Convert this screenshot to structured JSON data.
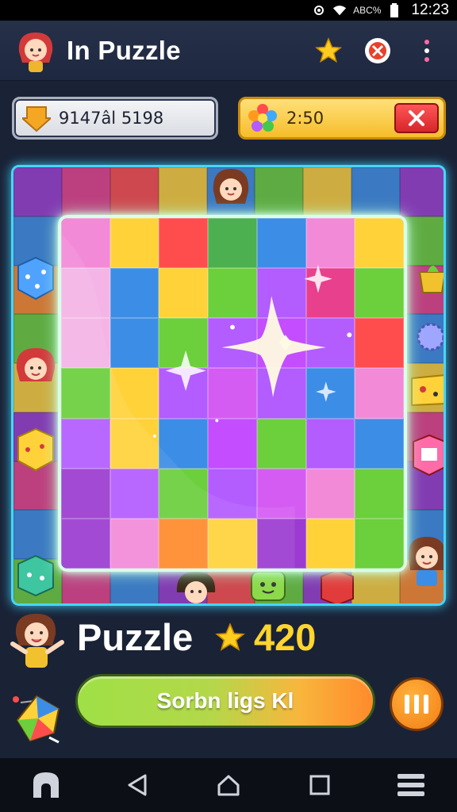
{
  "status_bar": {
    "carrier_text": "ABC%",
    "time": "12:23",
    "icons": [
      "settings-icon",
      "wifi-icon",
      "battery-icon"
    ]
  },
  "header": {
    "title": "In Puzzle",
    "icons": [
      "avatar",
      "star-icon",
      "no-ads-icon",
      "more-icon"
    ]
  },
  "info": {
    "left_value": "9147âl 5198",
    "left_icon": "arrow-down-icon",
    "right_value": "2:50",
    "right_icon": "flower-icon",
    "close_icon": "close-icon"
  },
  "footer": {
    "label": "Puzzle",
    "score": "420",
    "action_label": "Sorbn ligs Kl",
    "pause_icon": "pause-icon"
  },
  "nav": {
    "icons": [
      "app-icon",
      "back-icon",
      "home-icon",
      "recents-icon",
      "menu-icon"
    ]
  },
  "colors": {
    "accent_gold": "#ffd52e",
    "board_glow": "#48d6f7",
    "close_red": "#d6262a",
    "button_green": "#9fe046",
    "button_orange": "#ff8a2c"
  }
}
